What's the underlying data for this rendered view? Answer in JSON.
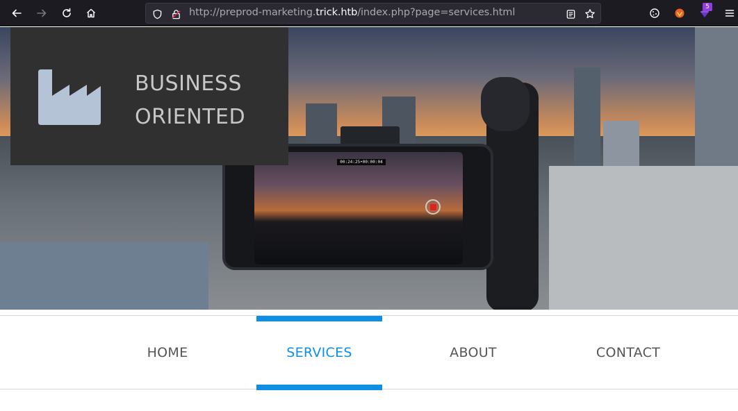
{
  "browser": {
    "url_prefix": "http://preprod-marketing.",
    "url_host": "trick.htb",
    "url_suffix": "/index.php?page=services.html",
    "extension_badge": "5",
    "icons": [
      "back-icon",
      "forward-icon",
      "reload-icon",
      "home-icon",
      "shield-icon",
      "lock-icon",
      "reader-view-icon",
      "bookmark-star-icon",
      "cookie-icon",
      "extension-icon",
      "extension-icon",
      "menu-icon"
    ]
  },
  "hero": {
    "logo_line1": "BUSINESS",
    "logo_line2": "ORIENTED",
    "logo_icon": "factory-icon",
    "recording_timer": "00:24:25•00:00:04"
  },
  "nav": {
    "items": [
      {
        "label": "HOME"
      },
      {
        "label": "SERVICES"
      },
      {
        "label": "ABOUT"
      },
      {
        "label": "CONTACT"
      }
    ],
    "active_color": "#0d8fe6",
    "text_color": "#555555"
  }
}
